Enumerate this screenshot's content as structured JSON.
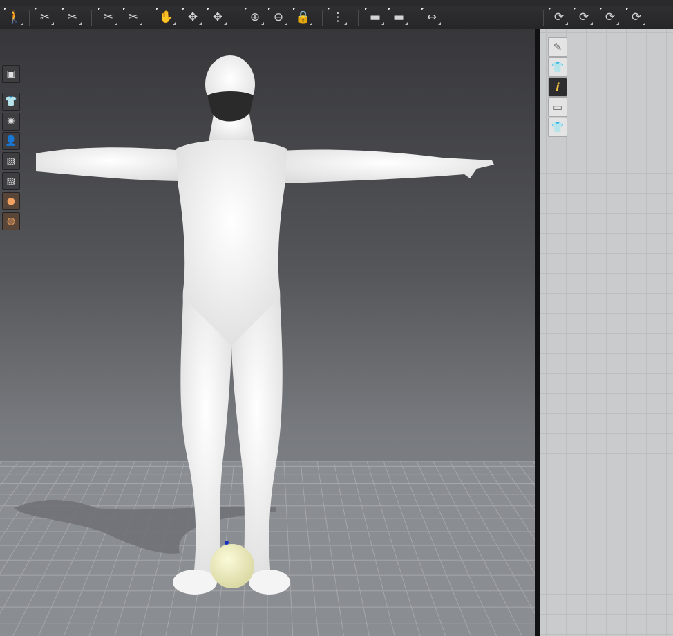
{
  "app": {
    "top_toolbar": {
      "tools": [
        {
          "name": "walk-pose-tool",
          "glyph": "🚶"
        },
        {
          "name": "arrange-tool",
          "glyph": "✂"
        },
        {
          "name": "transform-tool",
          "glyph": "✂"
        },
        {
          "name": "edit-pattern-tool",
          "glyph": "✂"
        },
        {
          "name": "edit-curve-tool",
          "glyph": "✂"
        },
        {
          "name": "fold-tool",
          "glyph": "✋"
        },
        {
          "name": "tack-tool",
          "glyph": "✥"
        },
        {
          "name": "pin-tool",
          "glyph": "✥"
        },
        {
          "name": "button-tool",
          "glyph": "⊕"
        },
        {
          "name": "buttonhole-tool",
          "glyph": "⊖"
        },
        {
          "name": "lock-tool",
          "glyph": "🔒"
        },
        {
          "name": "zipper-tool",
          "glyph": "⋮"
        },
        {
          "name": "fabric-tool",
          "glyph": "▬"
        },
        {
          "name": "texture-tool",
          "glyph": "▬"
        },
        {
          "name": "measure-tool",
          "glyph": "↔"
        },
        {
          "name": "sew-tool",
          "glyph": "⟳"
        },
        {
          "name": "segment-sew-tool",
          "glyph": "⟳"
        },
        {
          "name": "free-sew-tool",
          "glyph": "⟳"
        },
        {
          "name": "check-sew-tool",
          "glyph": "⟳"
        }
      ]
    },
    "viewport_left_tools": [
      {
        "name": "3d-garment-view-icon",
        "glyph": "▣"
      },
      {
        "name": "show-garment-icon",
        "glyph": "👕"
      },
      {
        "name": "show-particles-icon",
        "glyph": "✺"
      },
      {
        "name": "show-avatar-icon",
        "glyph": "👤"
      },
      {
        "name": "fabric-view-icon",
        "glyph": "▧"
      },
      {
        "name": "texture-view-icon",
        "glyph": "▨"
      },
      {
        "name": "skin-display-icon",
        "glyph": "●"
      },
      {
        "name": "avatar-mesh-icon",
        "glyph": "◍"
      }
    ],
    "panel_tools": [
      {
        "name": "edit-texture-icon",
        "glyph": "✎"
      },
      {
        "name": "show-garment-panel-icon",
        "glyph": "👕"
      },
      {
        "name": "info-icon",
        "glyph": "i"
      },
      {
        "name": "pattern-view-icon",
        "glyph": "▭"
      },
      {
        "name": "garment-lock-icon",
        "glyph": "👕"
      }
    ],
    "colors": {
      "viewport_top": "#37373a",
      "viewport_bottom": "#8c8f93",
      "avatar_skin": "#f2f2f2",
      "mask": "#2a2a2a",
      "ball": "#eeeec0",
      "panel": "#cacbcd"
    }
  }
}
